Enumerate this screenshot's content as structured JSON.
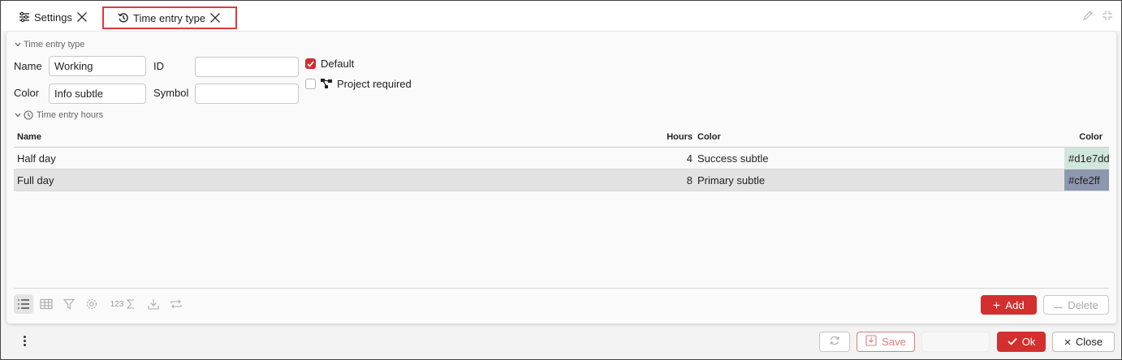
{
  "tabs": [
    {
      "label": "Settings",
      "icon": "sliders-icon"
    },
    {
      "label": "Time entry type",
      "icon": "history-icon",
      "active": true
    }
  ],
  "form": {
    "section_title": "Time entry type",
    "name_label": "Name",
    "name_value": "Working",
    "id_label": "ID",
    "id_value": "",
    "color_label": "Color",
    "color_value": "Info subtle",
    "symbol_label": "Symbol",
    "symbol_value": "",
    "default_label": "Default",
    "default_checked": true,
    "project_required_label": "Project required",
    "project_required_checked": false
  },
  "hours_grid": {
    "section_title": "Time entry hours",
    "columns": [
      "Name",
      "Hours",
      "Color",
      "Color"
    ],
    "rows": [
      {
        "name": "Half day",
        "hours": "4",
        "color": "Success subtle",
        "hex": "#d1e7dd",
        "swatch": "#d1e7dd",
        "selected": false
      },
      {
        "name": "Full day",
        "hours": "8",
        "color": "Primary subtle",
        "hex": "#cfe2ff",
        "swatch": "#8d97b0",
        "selected": true
      }
    ]
  },
  "toolbar": {
    "sum_label": "123",
    "add_label": "Add",
    "delete_label": "Delete"
  },
  "footer": {
    "save_label": "Save",
    "ok_label": "Ok",
    "close_label": "Close"
  },
  "colors": {
    "accent": "#d32f2f",
    "highlight_border": "#e0393e"
  }
}
